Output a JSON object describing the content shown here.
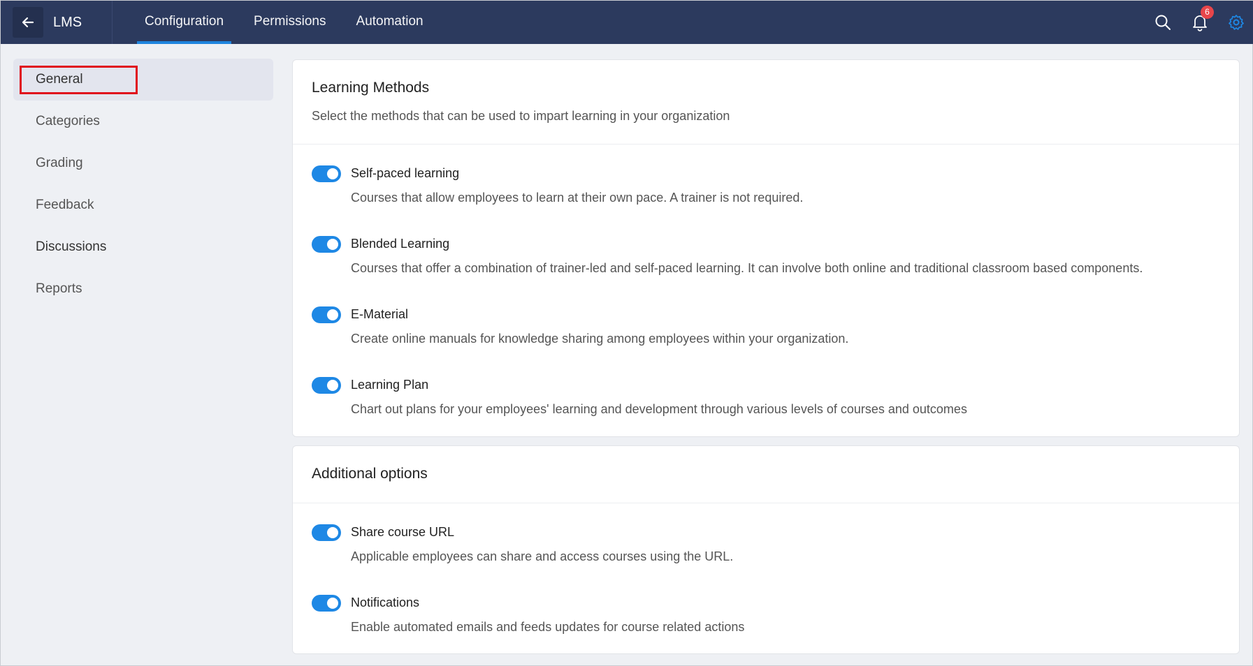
{
  "header": {
    "app_title": "LMS",
    "tabs": [
      {
        "label": "Configuration",
        "active": true
      },
      {
        "label": "Permissions",
        "active": false
      },
      {
        "label": "Automation",
        "active": false
      }
    ],
    "notification_count": "6",
    "icons": [
      "back-arrow-icon",
      "search-icon",
      "bell-icon",
      "gear-icon"
    ]
  },
  "sidebar": {
    "items": [
      {
        "label": "General",
        "active": true
      },
      {
        "label": "Categories"
      },
      {
        "label": "Grading"
      },
      {
        "label": "Feedback"
      },
      {
        "label": "Discussions"
      },
      {
        "label": "Reports"
      }
    ]
  },
  "learning_methods": {
    "title": "Learning Methods",
    "subtitle": "Select the methods that can be used to impart learning in your organization",
    "options": [
      {
        "title": "Self-paced learning",
        "desc": "Courses that allow employees to learn at their own pace. A trainer is not required.",
        "enabled": true
      },
      {
        "title": "Blended Learning",
        "desc": "Courses that offer a combination of trainer-led and self-paced learning. It can involve both online and traditional classroom based components.",
        "enabled": true
      },
      {
        "title": "E-Material",
        "desc": "Create online manuals for knowledge sharing among employees within your organization.",
        "enabled": true
      },
      {
        "title": "Learning Plan",
        "desc": "Chart out plans for your employees' learning and development through various levels of courses and outcomes",
        "enabled": true
      }
    ]
  },
  "additional_options": {
    "title": "Additional options",
    "options": [
      {
        "title": "Share course URL",
        "desc": "Applicable employees can share and access courses using the URL.",
        "enabled": true
      },
      {
        "title": "Notifications",
        "desc": "Enable automated emails and feeds updates for course related actions",
        "enabled": true
      }
    ]
  },
  "colors": {
    "header_bg": "#2c3a5e",
    "accent": "#1e88e5",
    "badge": "#e8454a",
    "highlight": "#e0101c"
  }
}
